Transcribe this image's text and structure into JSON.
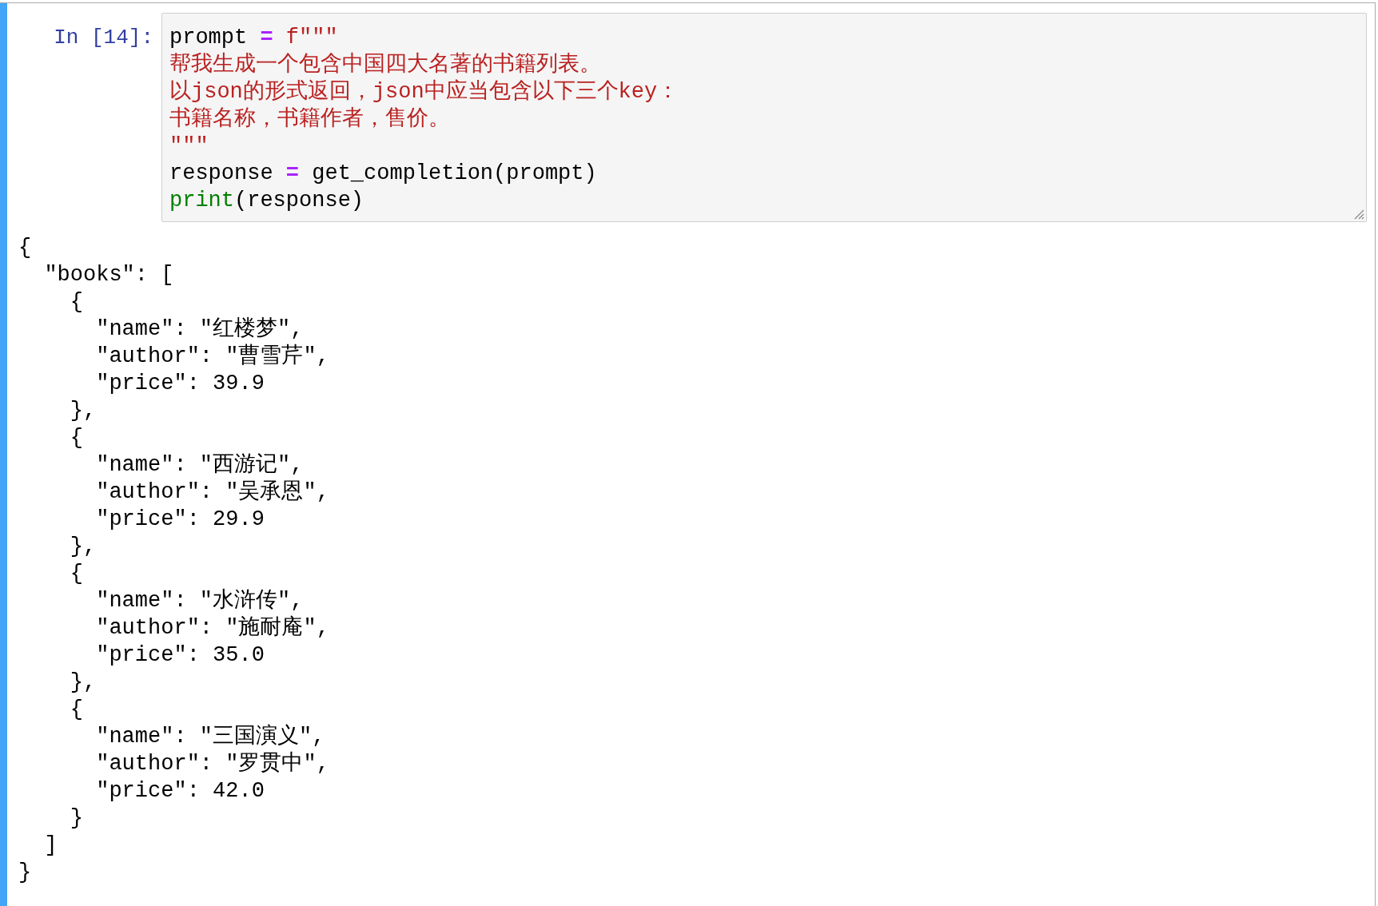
{
  "cell": {
    "prompt": "In [14]:",
    "input_lines": [
      [
        {
          "kind": "plain",
          "text": "prompt "
        },
        {
          "kind": "operator",
          "text": "="
        },
        {
          "kind": "string",
          "text": " f\"\"\""
        }
      ],
      [
        {
          "kind": "string",
          "text": "帮我生成一个包含中国四大名著的书籍列表。"
        }
      ],
      [
        {
          "kind": "string",
          "text": "以json的形式返回，json中应当包含以下三个key："
        }
      ],
      [
        {
          "kind": "string",
          "text": "书籍名称，书籍作者，售价。"
        }
      ],
      [
        {
          "kind": "string",
          "text": "\"\"\""
        }
      ],
      [
        {
          "kind": "plain",
          "text": "response "
        },
        {
          "kind": "operator",
          "text": "="
        },
        {
          "kind": "plain",
          "text": " get_completion(prompt)"
        }
      ],
      [
        {
          "kind": "builtin",
          "text": "print"
        },
        {
          "kind": "plain",
          "text": "(response)"
        }
      ]
    ],
    "output_lines": [
      "{",
      "  \"books\": [",
      "    {",
      "      \"name\": \"红楼梦\",",
      "      \"author\": \"曹雪芹\",",
      "      \"price\": 39.9",
      "    },",
      "    {",
      "      \"name\": \"西游记\",",
      "      \"author\": \"吴承恩\",",
      "      \"price\": 29.9",
      "    },",
      "    {",
      "      \"name\": \"水浒传\",",
      "      \"author\": \"施耐庵\",",
      "      \"price\": 35.0",
      "    },",
      "    {",
      "      \"name\": \"三国演义\",",
      "      \"author\": \"罗贯中\",",
      "      \"price\": 42.0",
      "    }",
      "  ]",
      "}"
    ]
  }
}
